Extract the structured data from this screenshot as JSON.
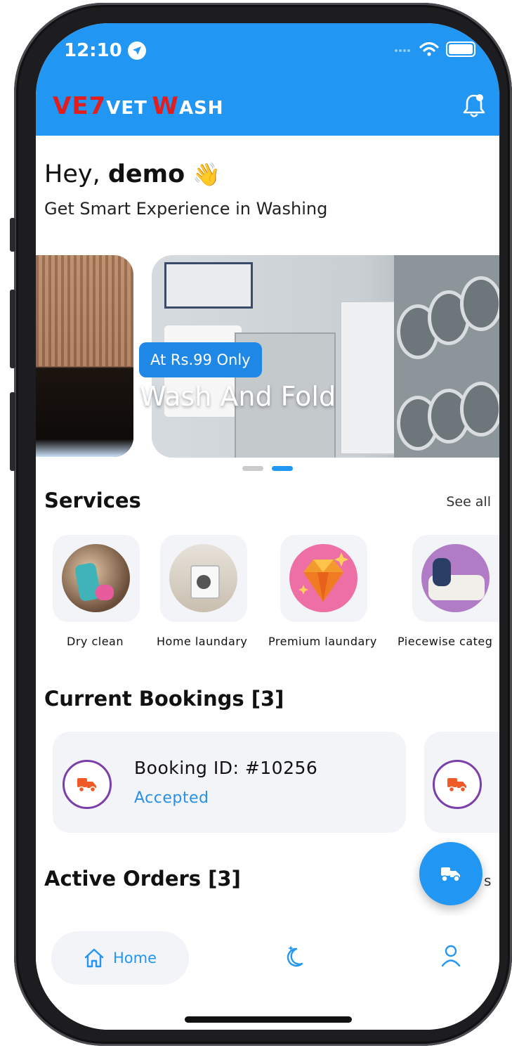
{
  "status_bar": {
    "time": "12:10"
  },
  "header": {
    "logo": {
      "p1_big": "V",
      "p2_big": "E7",
      "p3_small": "VET",
      "p4_big": "W",
      "p5_small": "ASH"
    }
  },
  "greeting": {
    "prefix": "Hey, ",
    "name": "demo",
    "emoji": "👋",
    "subtitle": "Get Smart Experience in Washing"
  },
  "banner": {
    "badge": "At Rs.99 Only",
    "title": "Wash And Fold",
    "active_index": 2,
    "count": 2
  },
  "services": {
    "title": "Services",
    "see_all": "See all",
    "items": [
      {
        "label": "Dry clean"
      },
      {
        "label": "Home laundary"
      },
      {
        "label": "Premium laundary"
      },
      {
        "label": "Piecewise categ"
      }
    ]
  },
  "bookings": {
    "title": "Current Bookings [3]",
    "items": [
      {
        "id": "Booking ID: #10256",
        "status": "Accepted"
      }
    ]
  },
  "orders": {
    "title": "Active Orders [3]",
    "peek": "s"
  },
  "nav": {
    "home": "Home"
  },
  "colors": {
    "primary": "#2196f3",
    "logo_red": "#e01e1e",
    "truck_ring": "#7a3fa8",
    "truck_icon": "#f05a28"
  }
}
